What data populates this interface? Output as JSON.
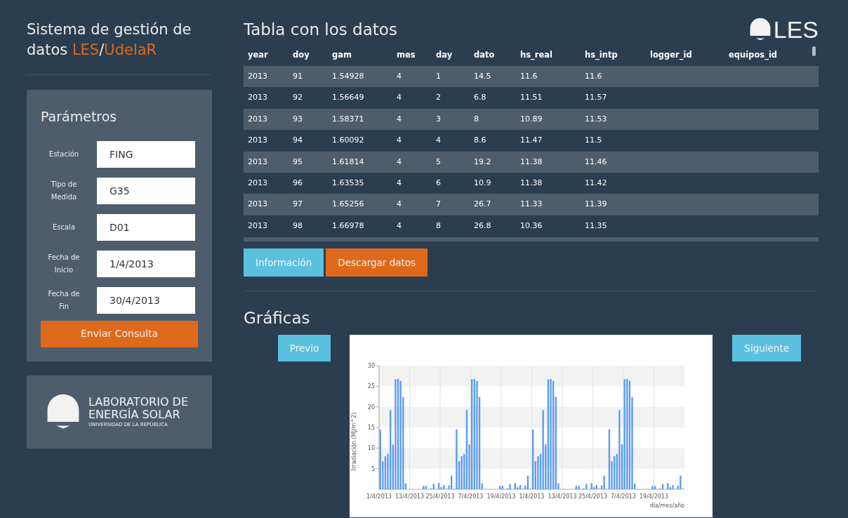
{
  "sidebar": {
    "title_parts": [
      {
        "text": "Sistema de gestión de datos ",
        "accent": false
      },
      {
        "text": "LES",
        "accent": true
      },
      {
        "text": "/",
        "accent": false
      },
      {
        "text": "UdelaR",
        "accent": true
      }
    ],
    "params": {
      "heading": "Parámetros",
      "fields": [
        {
          "label": "Estación",
          "value": "FING"
        },
        {
          "label": "Tipo de Medida",
          "value": "G35"
        },
        {
          "label": "Escala",
          "value": "D01"
        },
        {
          "label": "Fecha de Inicio",
          "value": "1/4/2013"
        },
        {
          "label": "Fecha de Fin",
          "value": "30/4/2013"
        }
      ],
      "submit": "Enviar Consulta"
    },
    "lab_logo": {
      "line1": "LABORATORIO DE",
      "line2": "ENERGÍA SOLAR",
      "line3": "UNIVERSIDAD DE LA REPÚBLICA"
    }
  },
  "header": {
    "title": "Tabla con los datos",
    "logo_text": "LES"
  },
  "table": {
    "columns": [
      "year",
      "doy",
      "gam",
      "mes",
      "day",
      "dato",
      "hs_real",
      "hs_intp",
      "logger_id",
      "equipos_id"
    ],
    "rows": [
      [
        "2013",
        "91",
        "1.54928",
        "4",
        "1",
        "14.5",
        "11.6",
        "11.6"
      ],
      [
        "2013",
        "92",
        "1.56649",
        "4",
        "2",
        "6.8",
        "11.51",
        "11.57"
      ],
      [
        "2013",
        "93",
        "1.58371",
        "4",
        "3",
        "8",
        "10.89",
        "11.53"
      ],
      [
        "2013",
        "94",
        "1.60092",
        "4",
        "4",
        "8.6",
        "11.47",
        "11.5"
      ],
      [
        "2013",
        "95",
        "1.61814",
        "4",
        "5",
        "19.2",
        "11.38",
        "11.46"
      ],
      [
        "2013",
        "96",
        "1.63535",
        "4",
        "6",
        "10.9",
        "11.38",
        "11.42"
      ],
      [
        "2013",
        "97",
        "1.65256",
        "4",
        "7",
        "26.7",
        "11.33",
        "11.39"
      ],
      [
        "2013",
        "98",
        "1.66978",
        "4",
        "8",
        "26.8",
        "10.36",
        "11.35"
      ]
    ]
  },
  "table_buttons": [
    {
      "label": "Información",
      "kind": "info"
    },
    {
      "label": "Descargar datos",
      "kind": "warning"
    }
  ],
  "charts": {
    "heading": "Gráficas",
    "prev": "Previo",
    "next": "Siguiente",
    "chart_data": {
      "type": "bar",
      "xlabel": "día/mes/año",
      "ylabel": "Irradiación (MJ/m^2)",
      "ylim": [
        0,
        30
      ],
      "yticks": [
        5,
        10,
        15,
        20,
        25,
        30
      ],
      "grid": true,
      "categories": [
        "1/4/2013",
        null,
        null,
        null,
        null,
        null,
        null,
        null,
        null,
        null,
        null,
        null,
        "13/4/2013",
        null,
        null,
        null,
        null,
        null,
        null,
        null,
        null,
        null,
        null,
        null,
        "25/4/2013",
        null,
        null,
        null,
        null,
        null,
        null,
        null,
        null,
        null,
        null,
        null,
        "7/4/2013",
        null,
        null,
        null,
        null,
        null,
        null,
        null,
        null,
        null,
        null,
        null,
        "19/4/2013",
        null,
        null,
        null,
        null,
        null,
        null,
        null,
        null,
        null,
        null,
        null,
        "1/4/2013",
        null,
        null,
        null,
        null,
        null,
        null,
        null,
        null,
        null,
        null,
        null,
        "13/4/2013",
        null,
        null,
        null,
        null,
        null,
        null,
        null,
        null,
        null,
        null,
        null,
        "25/4/2013",
        null,
        null,
        null,
        null,
        null,
        null,
        null,
        null,
        null,
        null,
        null,
        "7/4/2013",
        null,
        null,
        null,
        null,
        null,
        null,
        null,
        null,
        null,
        null,
        null,
        "19/4/2013",
        null,
        null,
        null,
        null,
        null,
        null,
        null,
        null,
        null,
        null,
        null
      ],
      "series": [
        {
          "color": "#5b9bef",
          "values": [
            14.5,
            6.8,
            8,
            8.6,
            19.2,
            10.9,
            26.7,
            26.8,
            26.3,
            22.4,
            1.4,
            0,
            0,
            0,
            0,
            0,
            0,
            0.8,
            0.8,
            0,
            0.2,
            1.3,
            0,
            1.5,
            0.5,
            1,
            0.1,
            0.9,
            3.3,
            0.1,
            14.5,
            6.8,
            8,
            8.6,
            19.2,
            10.9,
            26.7,
            26.8,
            26.3,
            22.4,
            1.4,
            0,
            0,
            0,
            0,
            0,
            0,
            0.8,
            0.8,
            0,
            0.2,
            1.3,
            0,
            1.5,
            0.5,
            1,
            0.1,
            0.9,
            3.3,
            0.1,
            14.5,
            6.8,
            8,
            8.6,
            19.2,
            10.9,
            26.7,
            26.8,
            26.3,
            22.4,
            1.4,
            0,
            0,
            0,
            0,
            0,
            0,
            0.8,
            0.8,
            0,
            0.2,
            1.3,
            0,
            1.5,
            0.5,
            1,
            0.1,
            0.9,
            3.3,
            0.1,
            14.5,
            6.8,
            8,
            8.6,
            19.2,
            10.9,
            26.7,
            26.8,
            26.3,
            22.4,
            1.4,
            0,
            0,
            0,
            0,
            0,
            0,
            0.8,
            0.8,
            0,
            0.2,
            1.3,
            0,
            1.5,
            0.5,
            1,
            0.1,
            0.9,
            3.3,
            0.1
          ]
        }
      ]
    }
  }
}
